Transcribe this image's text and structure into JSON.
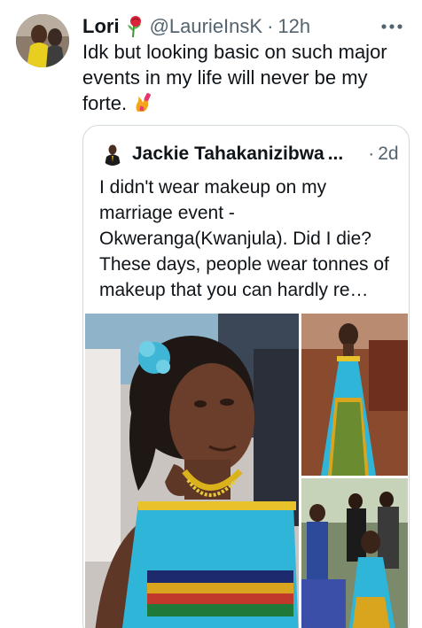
{
  "tweet": {
    "author_name": "Lori",
    "author_emoji": "rose-emoji",
    "handle": "@LaurieInsK",
    "separator": "·",
    "time": "12h",
    "text": "Idk but looking basic on such major events in my life will never be my forte.",
    "text_emoji": "nail-polish-emoji",
    "more_icon": "more-horizontal-icon"
  },
  "quoted": {
    "author_name": "Jackie Tahakanizibwa",
    "ellipsis": "...",
    "separator": "·",
    "time": "2d",
    "text": "I didn't wear makeup on my marriage event - Okweranga(Kwanjula). Did I die? These days, people wear tonnes of makeup that you can hardly re…",
    "photos": [
      "woman-smiling-blue-dress-photo",
      "woman-standing-blue-kente-dress-photo",
      "woman-with-guests-photo"
    ]
  },
  "colors": {
    "text_primary": "#0f1419",
    "text_secondary": "#536471",
    "border": "#cfd9de",
    "dress_blue": "#2fb5d8"
  }
}
